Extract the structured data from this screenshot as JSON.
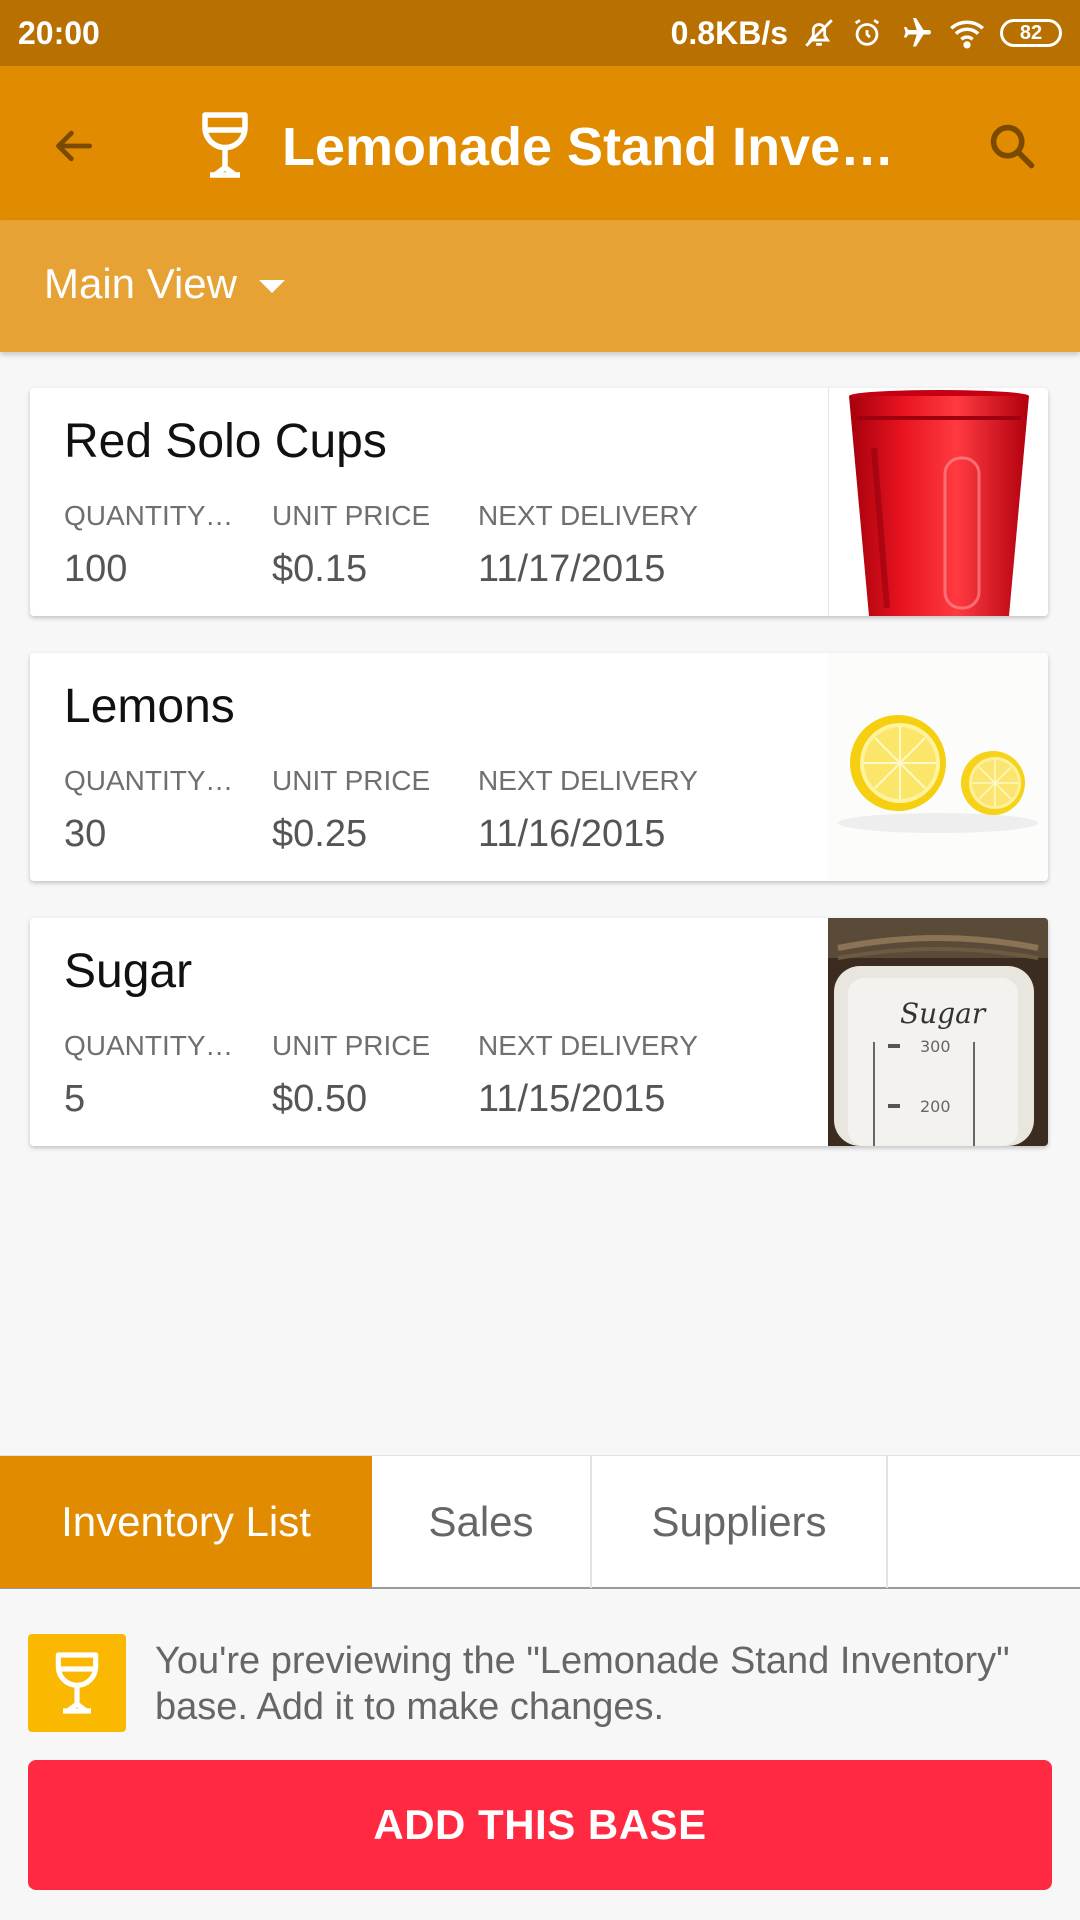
{
  "status_bar": {
    "time": "20:00",
    "speed": "0.8KB/s",
    "battery": "82"
  },
  "app_bar": {
    "title": "Lemonade Stand Invent…"
  },
  "view": {
    "label": "Main View"
  },
  "columns": {
    "quantity": "QUANTITY I…",
    "unit_price": "UNIT PRICE",
    "next_delivery": "NEXT DELIVERY"
  },
  "records": [
    {
      "name": "Red Solo Cups",
      "quantity": "100",
      "unit_price": "$0.15",
      "next_delivery": "11/17/2015",
      "image": "red-cup-image"
    },
    {
      "name": "Lemons",
      "quantity": "30",
      "unit_price": "$0.25",
      "next_delivery": "11/16/2015",
      "image": "lemon-image"
    },
    {
      "name": "Sugar",
      "quantity": "5",
      "unit_price": "$0.50",
      "next_delivery": "11/15/2015",
      "image": "sugar-jar-image"
    }
  ],
  "tabs": [
    {
      "label": "Inventory List",
      "active": true
    },
    {
      "label": "Sales",
      "active": false
    },
    {
      "label": "Suppliers",
      "active": false
    }
  ],
  "preview": {
    "message": "You're previewing the \"Lemonade Stand Inventory\" base. Add it to make changes.",
    "button_label": "ADD THIS BASE"
  },
  "colors": {
    "status_bar": "#b87000",
    "app_bar": "#e08b00",
    "view_bar": "#e6a235",
    "active_tab": "#e08b00",
    "add_button": "#ff2a42",
    "preview_icon_bg": "#fbb800"
  }
}
